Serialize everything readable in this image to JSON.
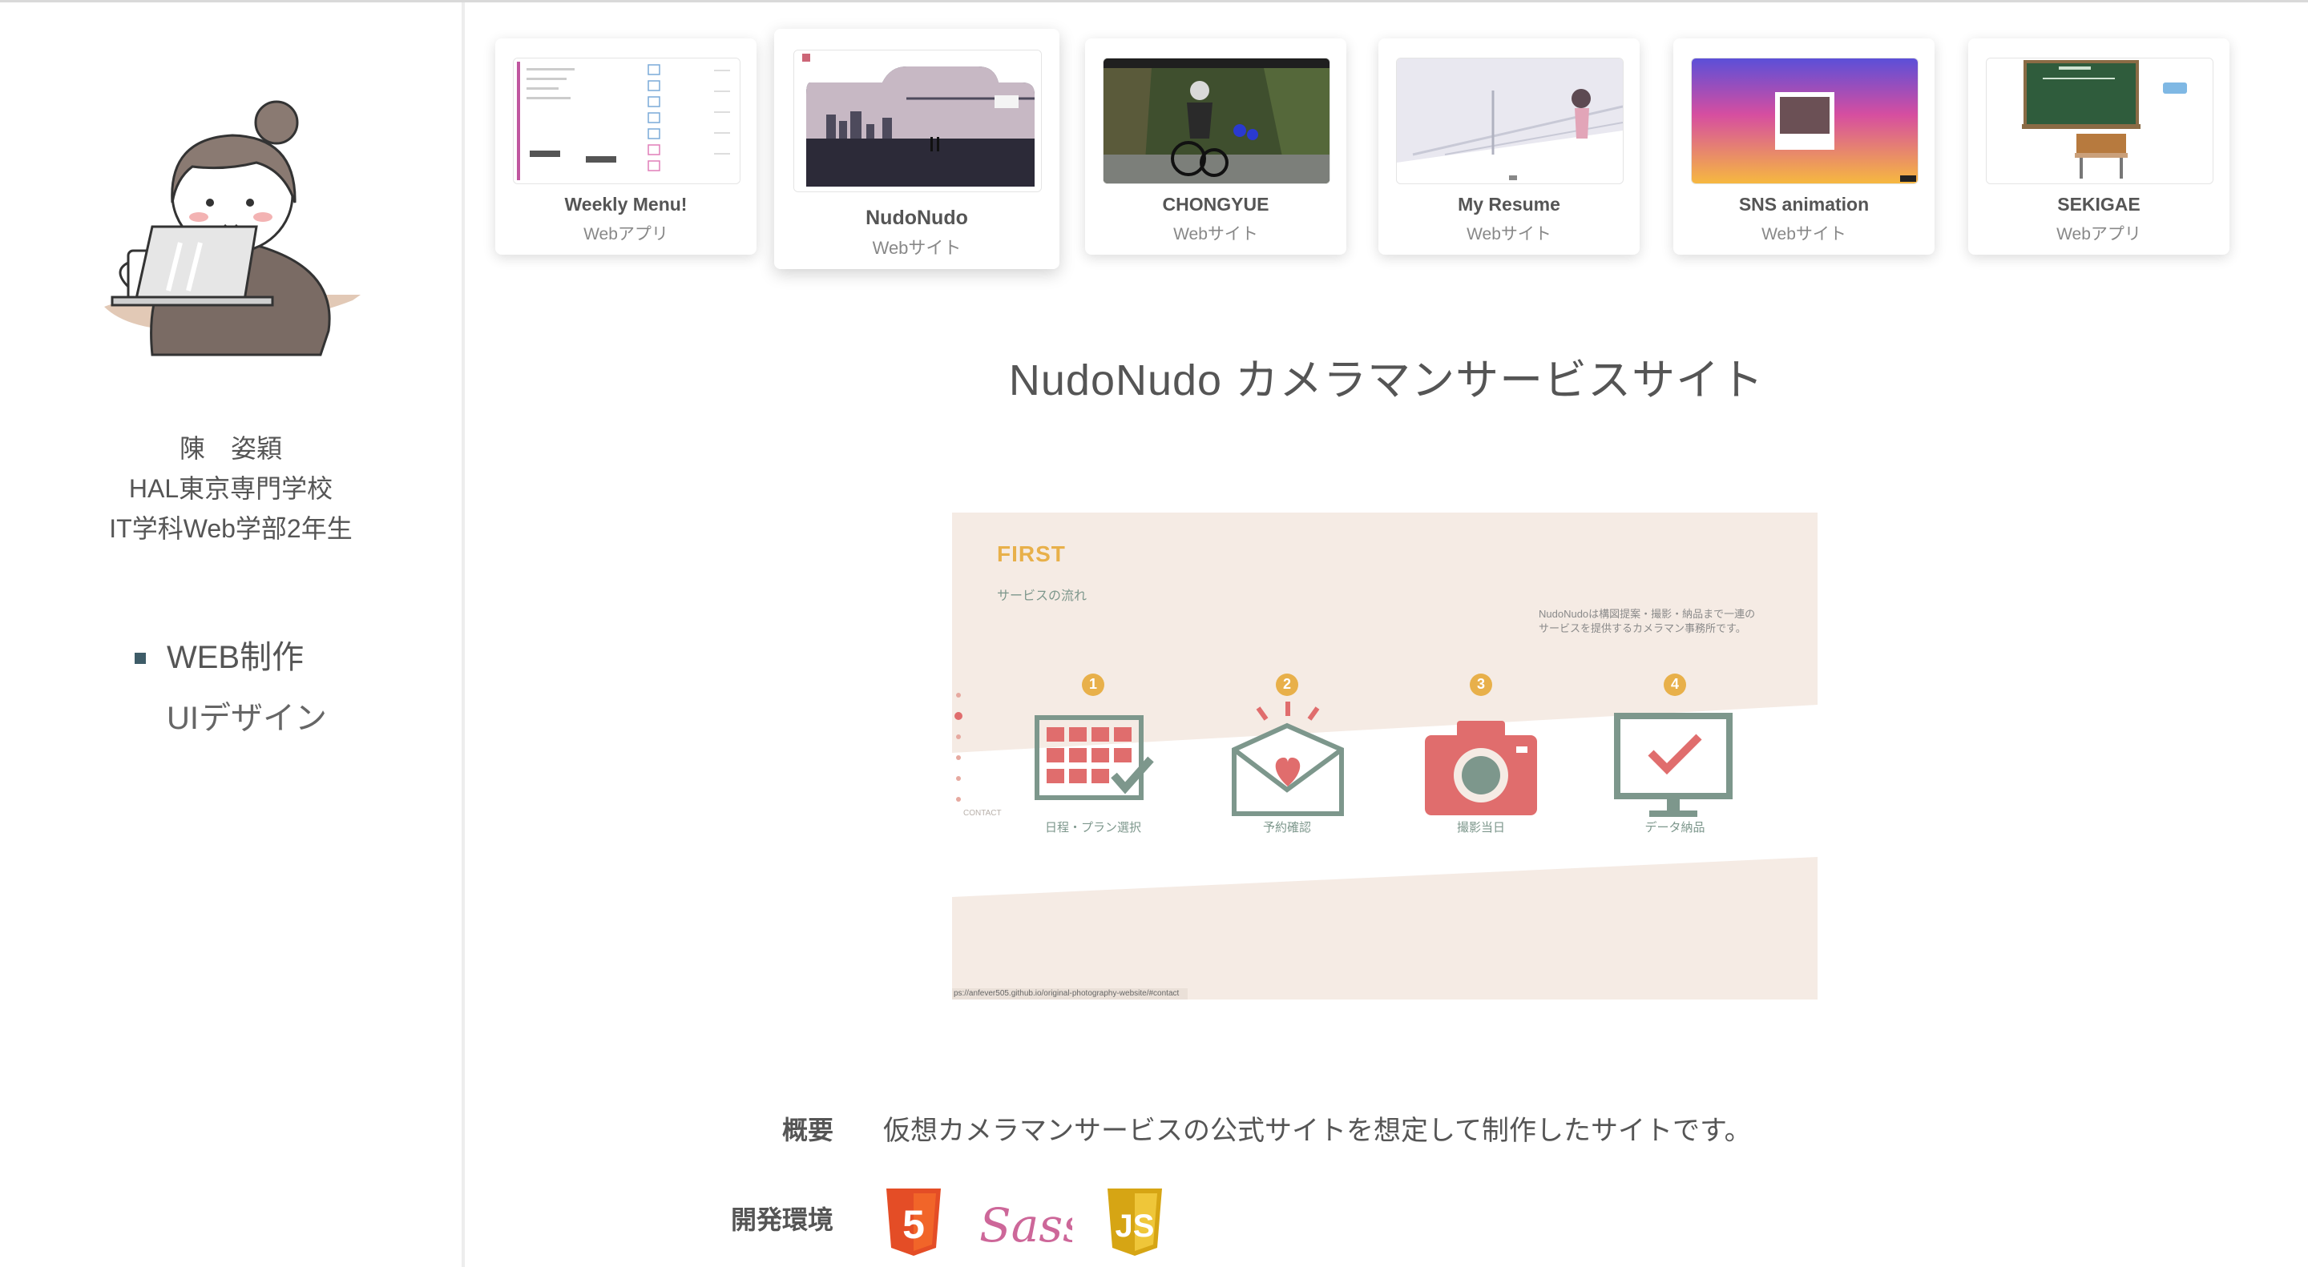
{
  "profile": {
    "name": "陳　姿穎",
    "school": "HAL東京専門学校",
    "department": "IT学科Web学部2年生"
  },
  "nav": {
    "items": [
      {
        "label": "WEB制作",
        "active": true
      },
      {
        "label": "UIデザイン",
        "active": false
      }
    ]
  },
  "works": [
    {
      "title": "Weekly Menu!",
      "type": "Webアプリ"
    },
    {
      "title": "NudoNudo",
      "type": "Webサイト",
      "selected": true
    },
    {
      "title": "CHONGYUE",
      "type": "Webサイト"
    },
    {
      "title": "My Resume",
      "type": "Webサイト"
    },
    {
      "title": "SNS animation",
      "type": "Webサイト"
    },
    {
      "title": "SEKIGAE",
      "type": "Webアプリ"
    }
  ],
  "detail": {
    "title": "NudoNudo カメラマンサービスサイト",
    "preview": {
      "logo": "FIRST",
      "heading": "サービスの流れ",
      "intro": [
        "NudoNudoは構図提案・撮影・納品まで一連の",
        "サービスを提供するカメラマン事務所です。"
      ],
      "side_label": "CONTACT",
      "steps": [
        {
          "num": "1",
          "label": "日程・プラン選択"
        },
        {
          "num": "2",
          "label": "予約確認"
        },
        {
          "num": "3",
          "label": "撮影当日"
        },
        {
          "num": "4",
          "label": "データ納品"
        }
      ],
      "status_url": "ps://anfever505.github.io/original-photography-website/#contact"
    },
    "overview_label": "概要",
    "overview_text": "仮想カメラマンサービスの公式サイトを想定して制作したサイトです。",
    "env_label": "開発環境",
    "tech": [
      {
        "name": "HTML5",
        "glyph": "5",
        "color": "#e44d26"
      },
      {
        "name": "Sass",
        "glyph": "Sass",
        "color": "#cd6799"
      },
      {
        "name": "JavaScript",
        "glyph": "JS",
        "color": "#d6a514"
      }
    ]
  },
  "colors": {
    "accent": "#3e5c68",
    "preview_bg": "#f5ebe4",
    "step_icon": "#7d978c",
    "step_num": "#e8b04a",
    "camera": "#e06d6d"
  }
}
